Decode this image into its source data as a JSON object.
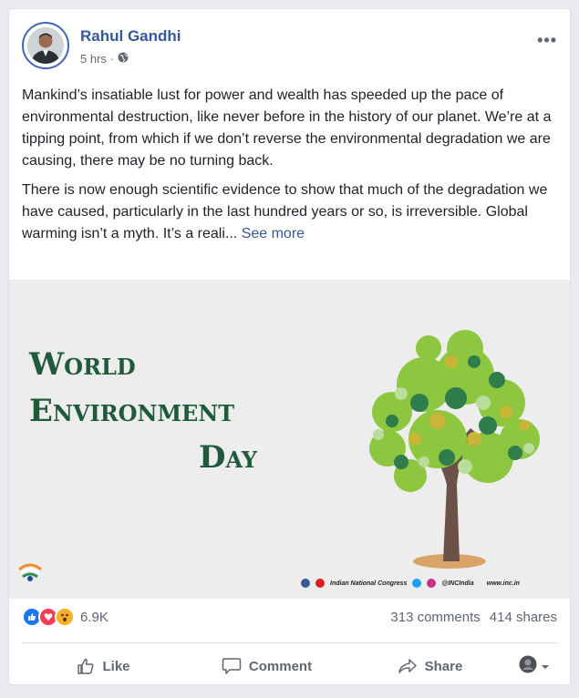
{
  "post": {
    "author": "Rahul Gandhi",
    "time": "5 hrs",
    "separator": "·",
    "privacy_icon": "globe-icon",
    "more_icon": "more-dots-icon",
    "paragraphs": [
      "Mankind’s insatiable lust for power and wealth has speeded up the pace of environmental destruction, like never before in the history of our planet. We’re at a tipping point, from which if we don’t reverse the environmental degradation we are causing, there may be no turning back.",
      "There is now enough scientific evidence to show that much of the degradation we have caused, particularly in the last hundred years or so, is irreversible. Global warming isn’t a myth. It’s a reali..."
    ],
    "see_more": "See more"
  },
  "banner": {
    "line1": "World",
    "line2": "Environment",
    "line3": "Day",
    "footer_org": "Indian National Congress",
    "footer_handle": "@INCIndia",
    "footer_site": "www.inc.in",
    "text_color": "#1f5a3a"
  },
  "stats": {
    "reactions": [
      "like",
      "love",
      "wow"
    ],
    "reaction_count": "6.9K",
    "comments": "313 comments",
    "shares": "414 shares"
  },
  "actions": {
    "like": "Like",
    "comment": "Comment",
    "share": "Share"
  },
  "colors": {
    "link": "#365899",
    "like": "#1877f2",
    "love": "#f33e58",
    "wow": "#f7b125"
  }
}
